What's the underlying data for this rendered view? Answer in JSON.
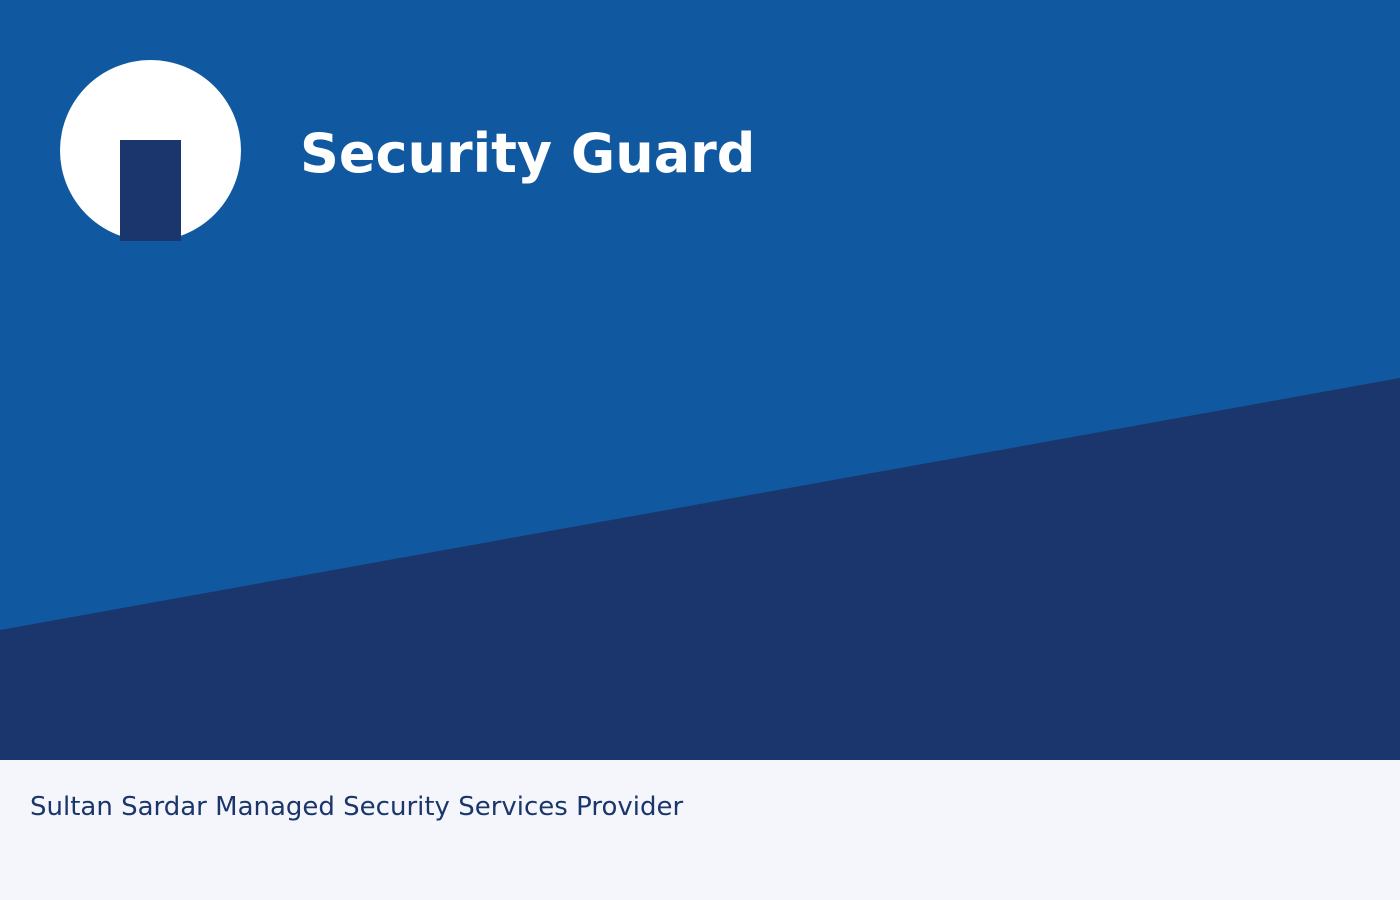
{
  "header": {
    "title": "Security Guard",
    "logo_icon": "security-guard-logo-icon"
  },
  "footer": {
    "text": "Sultan Sardar Managed Security Services Provider"
  },
  "colors": {
    "primary_blue": "#1059a0",
    "navy": "#1b366c",
    "white": "#ffffff",
    "footer_background": "#f4f6fb",
    "footer_text": "#1b366c"
  }
}
